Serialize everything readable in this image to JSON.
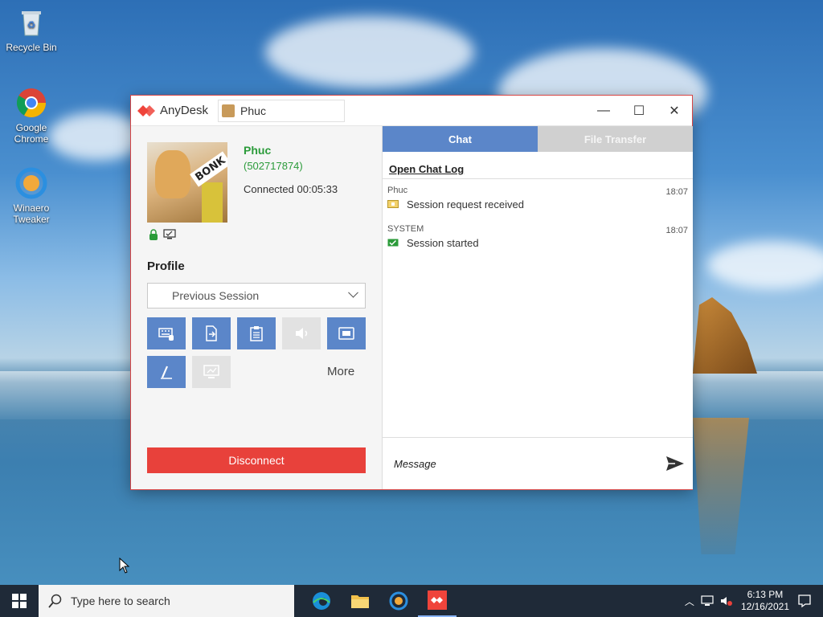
{
  "desktop": {
    "icons": [
      {
        "label": "Recycle Bin"
      },
      {
        "label": "Google Chrome"
      },
      {
        "label": "Winaero Tweaker"
      }
    ]
  },
  "window": {
    "app_name": "AnyDesk",
    "session_tab": "Phuc",
    "controls": {
      "minimize": "—",
      "maximize": "☐",
      "close": "✕"
    }
  },
  "peer": {
    "name": "Phuc",
    "id": "(502717874)",
    "status": "Connected 00:05:33",
    "avatar_text": "BONK"
  },
  "profile": {
    "label": "Profile",
    "selected": "Previous Session"
  },
  "actions": {
    "more_label": "More",
    "buttons": [
      {
        "name": "keyboard-button",
        "enabled": true
      },
      {
        "name": "file-transfer-button",
        "enabled": true
      },
      {
        "name": "clipboard-button",
        "enabled": true
      },
      {
        "name": "audio-button",
        "enabled": false
      },
      {
        "name": "screen-button",
        "enabled": true
      },
      {
        "name": "draw-button",
        "enabled": true
      },
      {
        "name": "monitor-button",
        "enabled": false
      }
    ]
  },
  "disconnect_label": "Disconnect",
  "tabs": [
    {
      "label": "Chat",
      "active": true
    },
    {
      "label": "File Transfer",
      "active": false
    }
  ],
  "chat": {
    "open_log": "Open Chat Log",
    "messages": [
      {
        "sender": "Phuc",
        "time": "18:07",
        "text": "Session request received"
      },
      {
        "sender": "SYSTEM",
        "time": "18:07",
        "text": "Session started"
      }
    ],
    "placeholder": "Message"
  },
  "taskbar": {
    "search_placeholder": "Type here to search",
    "time": "6:13 PM",
    "date": "12/16/2021"
  },
  "colors": {
    "accent": "#5b86c9",
    "disconnect": "#e8413b",
    "peer_green": "#2b9b3a",
    "anydesk_red": "#ef443b"
  }
}
